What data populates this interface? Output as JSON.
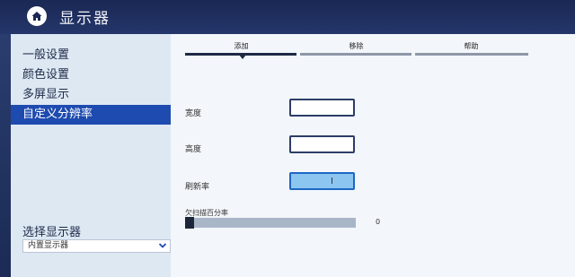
{
  "app": {
    "title": "显示器"
  },
  "sidebar": {
    "items": [
      {
        "label": "一般设置"
      },
      {
        "label": "颜色设置"
      },
      {
        "label": "多屏显示"
      },
      {
        "label": "自定义分辨率",
        "selected": true
      }
    ],
    "display_select": {
      "label": "选择显示器",
      "value": "内置显示器"
    }
  },
  "tabs": [
    {
      "label": "添加",
      "active": true
    },
    {
      "label": "移除"
    },
    {
      "label": "帮助"
    }
  ],
  "form": {
    "width_label": "宽度",
    "height_label": "高度",
    "refresh_label": "刷新率",
    "underscan_label": "欠扫描百分率",
    "underscan_value": "0"
  },
  "colors": {
    "accent": "#1e4bb0",
    "titlebar": "#1a2854",
    "focus_field": "#8cc6f0"
  },
  "icons": {
    "home": "home-icon",
    "dropdown": "chevron-down-icon",
    "cursor": "text-cursor-icon"
  }
}
